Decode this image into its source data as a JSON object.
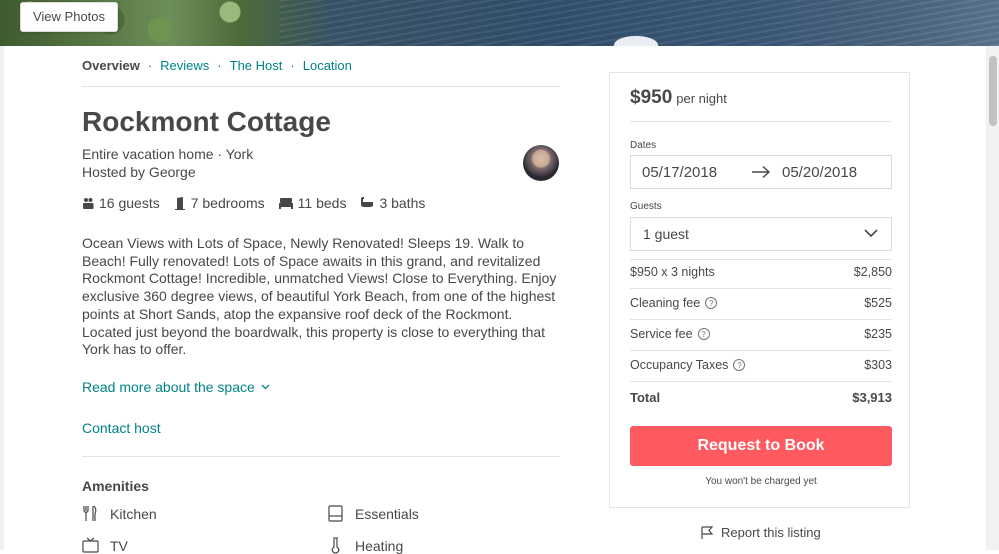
{
  "hero": {
    "view_photos_label": "View Photos"
  },
  "nav": {
    "items": [
      {
        "label": "Overview"
      },
      {
        "label": "Reviews"
      },
      {
        "label": "The Host"
      },
      {
        "label": "Location"
      }
    ],
    "separator": "·"
  },
  "listing": {
    "title": "Rockmont Cottage",
    "type_line": "Entire vacation home · York",
    "host_line": "Hosted by George",
    "stats": {
      "guests": "16 guests",
      "bedrooms": "7 bedrooms",
      "beds": "11 beds",
      "baths": "3 baths"
    },
    "description": "Ocean Views with Lots of Space, Newly Renovated! Sleeps 19. Walk to Beach! Fully renovated! Lots of Space awaits in this grand, and revitalized Rockmont Cottage! Incredible, unmatched Views! Close to Everything. Enjoy exclusive 360 degree views, of beautiful York Beach, from one of the highest points at Short Sands, atop the expansive roof deck of the Rockmont. Located just beyond the boardwalk, this property is close to everything that York has to offer.",
    "read_more": "Read more about the space",
    "contact_host": "Contact host"
  },
  "amenities": {
    "title": "Amenities",
    "items": [
      {
        "label": "Kitchen",
        "icon": "kitchen-icon"
      },
      {
        "label": "Essentials",
        "icon": "essentials-icon"
      },
      {
        "label": "TV",
        "icon": "tv-icon"
      },
      {
        "label": "Heating",
        "icon": "heating-icon"
      }
    ]
  },
  "booking": {
    "price": "$950",
    "per_night": "per night",
    "dates_label": "Dates",
    "check_in": "05/17/2018",
    "check_out": "05/20/2018",
    "guests_label": "Guests",
    "guests_value": "1 guest",
    "lines": [
      {
        "label": "$950 x 3 nights",
        "amount": "$2,850",
        "help": false
      },
      {
        "label": "Cleaning fee",
        "amount": "$525",
        "help": true
      },
      {
        "label": "Service fee",
        "amount": "$235",
        "help": true
      },
      {
        "label": "Occupancy Taxes",
        "amount": "$303",
        "help": true
      }
    ],
    "total_label": "Total",
    "total_amount": "$3,913",
    "button_label": "Request to Book",
    "charge_note": "You won't be charged yet"
  },
  "report": {
    "label": "Report this listing"
  },
  "colors": {
    "accent": "#008489",
    "button": "#ff5a5f",
    "text": "#484848",
    "border": "#e4e4e4"
  }
}
